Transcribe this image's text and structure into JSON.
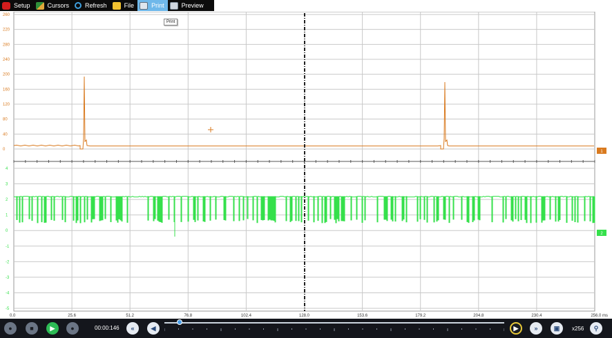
{
  "toolbar": {
    "setup_label": "Setup",
    "cursors_label": "Cursors",
    "refresh_label": "Refresh",
    "file_label": "File",
    "print_label": "Print",
    "preview_label": "Preview",
    "tooltip": "Print"
  },
  "colors": {
    "channel1": "#d97a1f",
    "channel2": "#35e04b",
    "grid": "#c8c8c8",
    "center_cursor": "#222222",
    "active_button": "#6fb8ea"
  },
  "channel1": {
    "marker": "1",
    "y_ticks": [
      "260",
      "220",
      "280",
      "240",
      "200",
      "160",
      "120",
      "80",
      "40",
      "0"
    ]
  },
  "channel2": {
    "marker": "2",
    "y_ticks": [
      "4",
      "3",
      "2",
      "1",
      "0",
      "-1",
      "-2",
      "-3",
      "-4",
      "-5"
    ]
  },
  "x_axis": {
    "ticks": [
      "0.0",
      "25.6",
      "51.2",
      "76.8",
      "102.4",
      "128.0",
      "153.6",
      "179.2",
      "204.8",
      "230.4",
      "256.0 ms"
    ]
  },
  "playback": {
    "time": "00:00:146",
    "zoom": "x256",
    "position_fraction": 0.045
  }
}
